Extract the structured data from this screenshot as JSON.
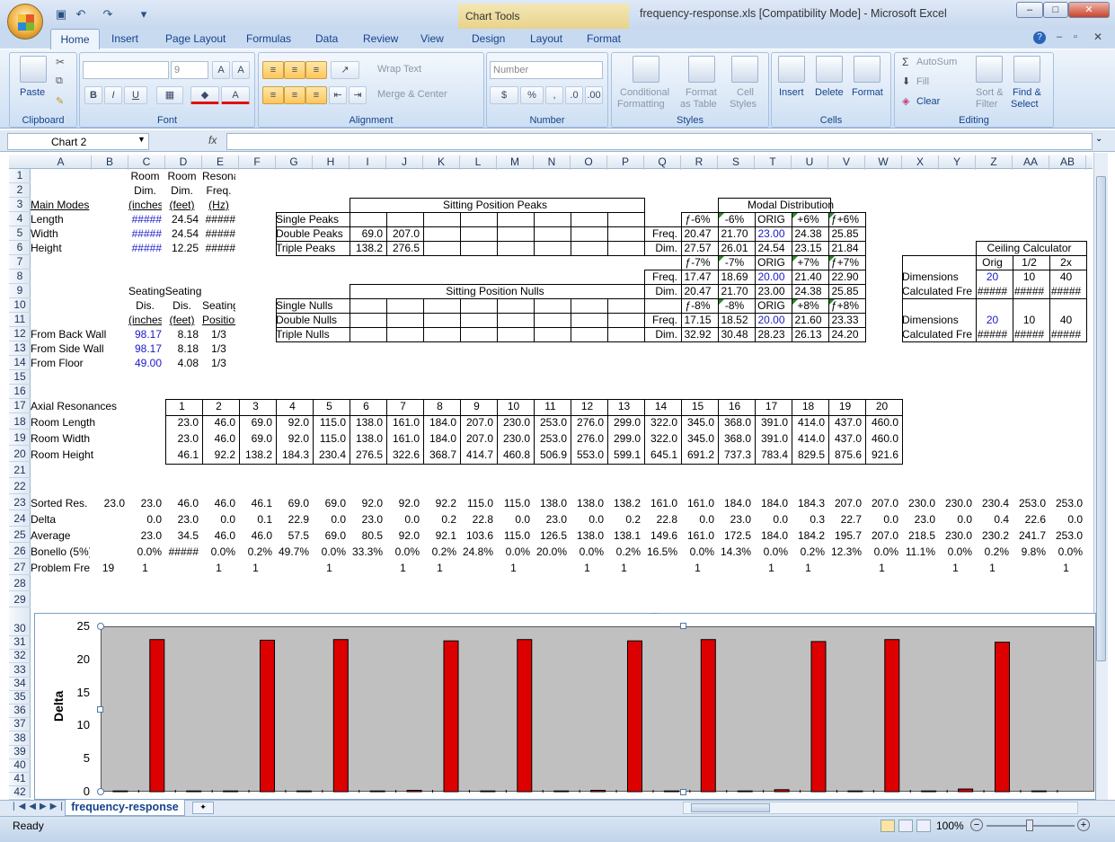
{
  "window": {
    "title": "frequency-response.xls  [Compatibility Mode] - Microsoft Excel",
    "context_tab": "Chart Tools"
  },
  "ribbon": {
    "tabs": [
      "Home",
      "Insert",
      "Page Layout",
      "Formulas",
      "Data",
      "Review",
      "View",
      "Design",
      "Layout",
      "Format"
    ],
    "groups": {
      "clipboard": "Clipboard",
      "font": "Font",
      "alignment": "Alignment",
      "number": "Number",
      "styles": "Styles",
      "cells": "Cells",
      "editing": "Editing"
    },
    "paste": "Paste",
    "font_size": "9",
    "wrap_text": "Wrap Text",
    "merge_center": "Merge & Center",
    "number_format": "Number",
    "cond_format": [
      "Conditional",
      "Formatting"
    ],
    "format_table": [
      "Format",
      "as Table"
    ],
    "cell_styles": [
      "Cell",
      "Styles"
    ],
    "insert": "Insert",
    "delete": "Delete",
    "format": "Format",
    "autosum": "AutoSum",
    "fill": "Fill",
    "clear": "Clear",
    "sort_filter": [
      "Sort &",
      "Filter"
    ],
    "find_select": [
      "Find &",
      "Select"
    ]
  },
  "formula_bar": {
    "name_box": "Chart 2",
    "fx": "fx"
  },
  "columns": [
    "A",
    "B",
    "C",
    "D",
    "E",
    "F",
    "G",
    "H",
    "I",
    "J",
    "K",
    "L",
    "M",
    "N",
    "O",
    "P",
    "Q",
    "R",
    "S",
    "T",
    "U",
    "V",
    "W",
    "X",
    "Y",
    "Z",
    "AA",
    "AB"
  ],
  "rows": [
    "1",
    "2",
    "3",
    "4",
    "5",
    "6",
    "7",
    "8",
    "9",
    "10",
    "11",
    "12",
    "13",
    "14",
    "15",
    "16",
    "17",
    "18",
    "19",
    "20",
    "21",
    "22",
    "23",
    "24",
    "25",
    "26",
    "27",
    "28",
    "29",
    "30",
    "31",
    "32",
    "33",
    "34",
    "35",
    "36",
    "37",
    "38",
    "39",
    "40",
    "41",
    "42"
  ],
  "cells": {
    "hdr1": [
      "Room",
      "Room",
      "Resonant"
    ],
    "hdr2": [
      "Dim.",
      "Dim.",
      "Freq."
    ],
    "hdr3": [
      "(inches",
      "(feet)",
      "(Hz)"
    ],
    "main_modes": "Main Modes",
    "modes": [
      [
        "Length",
        "#####",
        "24.54",
        "#####"
      ],
      [
        "Width",
        "#####",
        "24.54",
        "#####"
      ],
      [
        "Height",
        "#####",
        "12.25",
        "#####"
      ]
    ],
    "seat_hdr1": [
      "SeatingSeating"
    ],
    "seat_hdr2": [
      "Dis.",
      "Dis.",
      "Seating"
    ],
    "seat_hdr3": [
      "(inches",
      "(feet)",
      "Position"
    ],
    "seating": [
      [
        "From Back Wall",
        "98.17",
        "8.18",
        "1/3"
      ],
      [
        "From Side Wall",
        "98.17",
        "8.18",
        "1/3"
      ],
      [
        "From Floor",
        "49.00",
        "4.08",
        "1/3"
      ]
    ],
    "peaks_title": "Sitting Position Peaks",
    "peaks": [
      [
        "Single Peaks",
        "",
        ""
      ],
      [
        "Double Peaks",
        "69.0",
        "207.0"
      ],
      [
        "Triple Peaks",
        "138.2",
        "276.5"
      ]
    ],
    "nulls_title": "Sitting Position Nulls",
    "nulls": [
      "Single Nulls",
      "Double Nulls",
      "Triple Nulls"
    ],
    "modal_title": "Modal Distribution",
    "modal": [
      [
        "",
        "ƒ-6%",
        "-6%",
        "ORIG",
        "+6%",
        "ƒ+6%"
      ],
      [
        "Freq.",
        "20.47",
        "21.70",
        "23.00",
        "24.38",
        "25.85"
      ],
      [
        "Dim.",
        "27.57",
        "26.01",
        "24.54",
        "23.15",
        "21.84"
      ],
      [
        "",
        "ƒ-7%",
        "-7%",
        "ORIG",
        "+7%",
        "ƒ+7%"
      ],
      [
        "Freq.",
        "17.47",
        "18.69",
        "20.00",
        "21.40",
        "22.90"
      ],
      [
        "Dim.",
        "20.47",
        "21.70",
        "23.00",
        "24.38",
        "25.85"
      ],
      [
        "",
        "ƒ-8%",
        "-8%",
        "ORIG",
        "+8%",
        "ƒ+8%"
      ],
      [
        "Freq.",
        "17.15",
        "18.52",
        "20.00",
        "21.60",
        "23.33"
      ],
      [
        "Dim.",
        "32.92",
        "30.48",
        "28.23",
        "26.13",
        "24.20"
      ]
    ],
    "ceiling_title": "Ceiling Calculator",
    "ceiling_hdr": [
      "Orig",
      "1/2",
      "2x"
    ],
    "ceiling": [
      [
        "Dimensions",
        "20",
        "10",
        "40"
      ],
      [
        "Calculated Fre",
        "#####",
        "#####",
        "#####"
      ],
      [
        "Dimensions",
        "20",
        "10",
        "40"
      ],
      [
        "Calculated Fre",
        "#####",
        "#####",
        "#####"
      ]
    ],
    "axial_label": "Axial Resonances",
    "axial_idx": [
      "1",
      "2",
      "3",
      "4",
      "5",
      "6",
      "7",
      "8",
      "9",
      "10",
      "11",
      "12",
      "13",
      "14",
      "15",
      "16",
      "17",
      "18",
      "19",
      "20"
    ],
    "axial": [
      [
        "Room Length",
        "23.0",
        "46.0",
        "69.0",
        "92.0",
        "115.0",
        "138.0",
        "161.0",
        "184.0",
        "207.0",
        "230.0",
        "253.0",
        "276.0",
        "299.0",
        "322.0",
        "345.0",
        "368.0",
        "391.0",
        "414.0",
        "437.0",
        "460.0"
      ],
      [
        "Room Width",
        "23.0",
        "46.0",
        "69.0",
        "92.0",
        "115.0",
        "138.0",
        "161.0",
        "184.0",
        "207.0",
        "230.0",
        "253.0",
        "276.0",
        "299.0",
        "322.0",
        "345.0",
        "368.0",
        "391.0",
        "414.0",
        "437.0",
        "460.0"
      ],
      [
        "Room Height",
        "46.1",
        "92.2",
        "138.2",
        "184.3",
        "230.4",
        "276.5",
        "322.6",
        "368.7",
        "414.7",
        "460.8",
        "506.9",
        "553.0",
        "599.1",
        "645.1",
        "691.2",
        "737.3",
        "783.4",
        "829.5",
        "875.6",
        "921.6"
      ]
    ],
    "sorted": [
      "Sorted Res.",
      "23.0",
      "23.0",
      "46.0",
      "46.0",
      "46.1",
      "69.0",
      "69.0",
      "92.0",
      "92.0",
      "92.2",
      "115.0",
      "115.0",
      "138.0",
      "138.0",
      "138.2",
      "161.0",
      "161.0",
      "184.0",
      "184.0",
      "184.3",
      "207.0",
      "207.0",
      "230.0",
      "230.0",
      "230.4",
      "253.0",
      "253.0"
    ],
    "delta": [
      "Delta",
      "",
      "0.0",
      "23.0",
      "0.0",
      "0.1",
      "22.9",
      "0.0",
      "23.0",
      "0.0",
      "0.2",
      "22.8",
      "0.0",
      "23.0",
      "0.0",
      "0.2",
      "22.8",
      "0.0",
      "23.0",
      "0.0",
      "0.3",
      "22.7",
      "0.0",
      "23.0",
      "0.0",
      "0.4",
      "22.6",
      "0.0"
    ],
    "average": [
      "Average",
      "",
      "23.0",
      "34.5",
      "46.0",
      "46.0",
      "57.5",
      "69.0",
      "80.5",
      "92.0",
      "92.1",
      "103.6",
      "115.0",
      "126.5",
      "138.0",
      "138.1",
      "149.6",
      "161.0",
      "172.5",
      "184.0",
      "184.2",
      "195.7",
      "207.0",
      "218.5",
      "230.0",
      "230.2",
      "241.7",
      "253.0"
    ],
    "bonello": [
      "Bonello (5%)",
      "",
      "0.0%",
      "#####",
      "0.0%",
      "0.2%",
      "49.7%",
      "0.0%",
      "33.3%",
      "0.0%",
      "0.2%",
      "24.8%",
      "0.0%",
      "20.0%",
      "0.0%",
      "0.2%",
      "16.5%",
      "0.0%",
      "14.3%",
      "0.0%",
      "0.2%",
      "12.3%",
      "0.0%",
      "11.1%",
      "0.0%",
      "0.2%",
      "9.8%",
      "0.0%"
    ],
    "problem": [
      "Problem Fre",
      "19",
      "1",
      "",
      "1",
      "1",
      "",
      "1",
      "",
      "1",
      "1",
      "",
      "1",
      "",
      "1",
      "1",
      "",
      "1",
      "",
      "1",
      "1",
      "",
      "1",
      "",
      "1",
      "1",
      "",
      "1"
    ]
  },
  "chart_data": {
    "type": "bar",
    "ylabel": "Delta",
    "ylim": [
      0,
      25
    ],
    "yticks": [
      "0",
      "5",
      "10",
      "15",
      "20",
      "25"
    ],
    "values": [
      0.0,
      0.0,
      23.0,
      0.0,
      0.1,
      22.9,
      0.0,
      23.0,
      0.0,
      0.2,
      22.8,
      0.0,
      23.0,
      0.0,
      0.2,
      22.8,
      0.0,
      23.0,
      0.0,
      0.3,
      22.7,
      0.0,
      23.0,
      0.0,
      0.4,
      22.6,
      0.0
    ],
    "bar_color": "#dd0000",
    "plot_bg": "#c0c0c0"
  },
  "sheet": {
    "tab": "frequency-response"
  },
  "status": {
    "ready": "Ready",
    "zoom": "100%"
  }
}
